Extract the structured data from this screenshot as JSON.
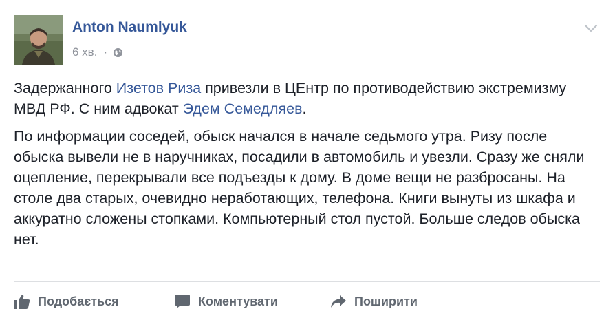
{
  "post": {
    "author": "Anton Naumlyuk",
    "time": "6 хв.",
    "separator": "·",
    "privacy_icon": "globe-icon",
    "menu_icon": "chevron-down-icon",
    "paragraph1": {
      "t1": "Задержанного ",
      "link1": "Изетов Риза",
      "t2": " привезли в ЦЕнтр по противодействию экстремизму МВД РФ. С ним адвокат ",
      "link2": "Эдем Семедляев",
      "t3": "."
    },
    "paragraph2": "По информации соседей, обыск начался в начале седьмого утра. Ризу после обыска вывели не в наручниках, посадили в автомобиль и увезли. Сразу же сняли оцепление, перекрывали все подъезды к дому. В доме вещи не разбросаны. На столе два старых, очевидно неработающих, телефона. Книги вынуты из шкафа и аккуратно сложены стопками. Компьютерный стол пустой. Больше следов обыска нет."
  },
  "actions": {
    "like": "Подобається",
    "comment": "Коментувати",
    "share": "Поширити"
  },
  "colors": {
    "link": "#365899",
    "text": "#1d2129",
    "muted": "#90949c",
    "action": "#606770"
  }
}
